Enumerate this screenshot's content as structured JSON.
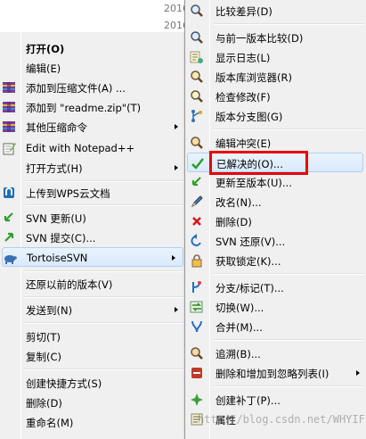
{
  "background": {
    "dates": [
      "2016",
      "2016"
    ]
  },
  "left_menu": {
    "items": [
      {
        "label": "打开(O)",
        "bold": true
      },
      {
        "label": "编辑(E)"
      },
      {
        "label": "添加到压缩文件(A) ..."
      },
      {
        "label": "添加到 \"readme.zip\"(T)"
      },
      {
        "label": "其他压缩命令"
      },
      {
        "label": "Edit with Notepad++"
      },
      {
        "label": "打开方式(H)"
      },
      {
        "label": "上传到WPS云文档"
      },
      {
        "label": "SVN 更新(U)"
      },
      {
        "label": "SVN 提交(C)..."
      },
      {
        "label": "TortoiseSVN"
      },
      {
        "label": "还原以前的版本(V)"
      },
      {
        "label": "发送到(N)"
      },
      {
        "label": "剪切(T)"
      },
      {
        "label": "复制(C)"
      },
      {
        "label": "创建快捷方式(S)"
      },
      {
        "label": "删除(D)"
      },
      {
        "label": "重命名(M)"
      }
    ]
  },
  "right_menu": {
    "items": [
      {
        "label": "比较差异(D)"
      },
      {
        "label": "与前一版本比较(D)"
      },
      {
        "label": "显示日志(L)"
      },
      {
        "label": "版本库浏览器(R)"
      },
      {
        "label": "检查修改(F)"
      },
      {
        "label": "版本分支图(G)"
      },
      {
        "label": "编辑冲突(E)"
      },
      {
        "label": "已解决的(O)..."
      },
      {
        "label": "更新至版本(U)..."
      },
      {
        "label": "改名(N)..."
      },
      {
        "label": "删除(D)"
      },
      {
        "label": "SVN 还原(V)..."
      },
      {
        "label": "获取锁定(K)..."
      },
      {
        "label": "分支/标记(T)..."
      },
      {
        "label": "切换(W)..."
      },
      {
        "label": "合并(M)..."
      },
      {
        "label": "追溯(B)..."
      },
      {
        "label": "删除和增加到忽略列表(I)"
      },
      {
        "label": "创建补丁(P)..."
      },
      {
        "label": "属性"
      }
    ]
  },
  "watermark": "http://blog.csdn.net/WHYIF",
  "colors": {
    "highlight_box": "#e8000a",
    "menu_bg": "#f0f0f0",
    "hover_bg": "#d9e9fc"
  }
}
